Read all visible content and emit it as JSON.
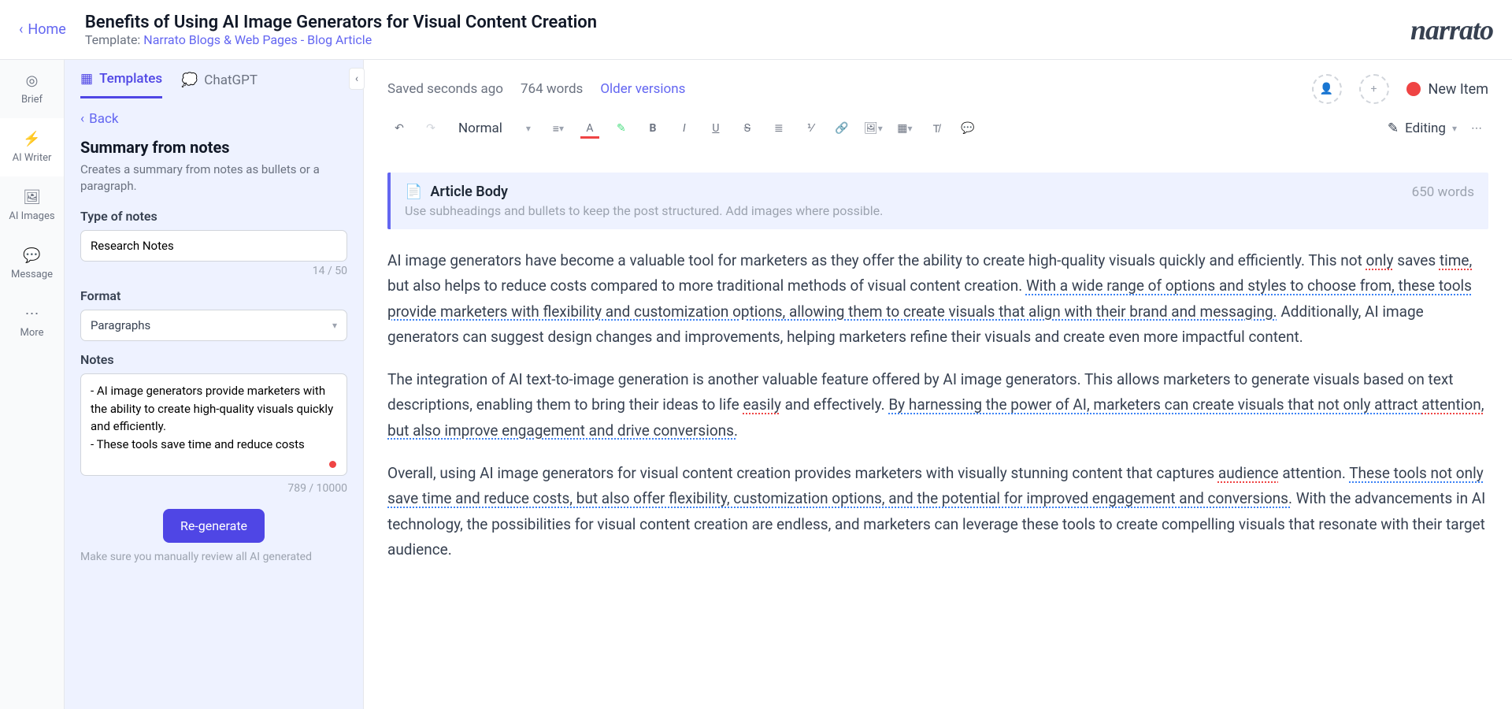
{
  "home_label": "Home",
  "page_title": "Benefits of Using AI Image Generators for Visual Content Creation",
  "template_prefix": "Template: ",
  "template_link": "Narrato Blogs & Web Pages - Blog Article",
  "logo": "narrato",
  "rail": {
    "brief": "Brief",
    "ai_writer": "AI Writer",
    "ai_images": "AI Images",
    "message": "Message",
    "more": "More"
  },
  "tabs": {
    "templates": "Templates",
    "chatgpt": "ChatGPT"
  },
  "back": "Back",
  "summary": {
    "title": "Summary from notes",
    "desc": "Creates a summary from notes as bullets or a paragraph.",
    "type_label": "Type of notes",
    "type_value": "Research Notes",
    "type_counter": "14 / 50",
    "format_label": "Format",
    "format_value": "Paragraphs",
    "notes_label": "Notes",
    "notes_value": "- AI image generators provide marketers with the ability to create high-quality visuals quickly and efficiently.\n- These tools save time and reduce costs",
    "notes_counter": "789 / 10000",
    "regenerate": "Re-generate",
    "disclaimer": "Make sure you manually review all AI generated"
  },
  "status": {
    "saved": "Saved seconds ago",
    "words": "764 words",
    "older": "Older versions",
    "new_item": "New Item"
  },
  "toolbar": {
    "style": "Normal",
    "mode": "Editing"
  },
  "article": {
    "title": "Article Body",
    "words": "650 words",
    "hint": "Use subheadings and bullets to keep the post structured. Add images where possible.",
    "p1a": "AI image generators have become a valuable tool for marketers as they offer the ability to create high-quality visuals quickly and efficiently. This not ",
    "p1only": "only",
    "p1b": " saves ",
    "p1time": "time,",
    "p1c": " but also helps to reduce costs compared to more traditional methods of visual content creation. ",
    "p1g1": "With a wide range of options and styles to choose from, these tools provide marketers with flexibility and customization options, allowing them to create visuals that align with their brand and messaging.",
    "p1d": " Additionally, AI image generators can suggest design changes and improvements, helping marketers refine their visuals and create even more impactful content.",
    "p2a": "The integration of AI text-to-image generation is another valuable feature offered by AI image generators. This allows marketers to generate visuals based on text descriptions, enabling them to bring their ideas to life ",
    "p2easily": "easily",
    "p2b": " and effectively. ",
    "p2g1": "By harnessing the power of AI, marketers can create visuals that not only attract ",
    "p2att": "attention,",
    "p2g2": " but also improve engagement and drive conversions.",
    "p3a": "Overall, using AI image generators for visual content creation provides marketers with visually stunning content that captures ",
    "p3aud": "audience",
    "p3b": " attention. ",
    "p3g1": "These tools not only save time and reduce costs, but also offer flexibility, customization options, and the potential for improved engagement and conversions.",
    "p3c": " With the advancements in AI technology, the possibilities for visual content creation are endless, and marketers can leverage these tools to create compelling visuals that resonate with their target audience."
  }
}
